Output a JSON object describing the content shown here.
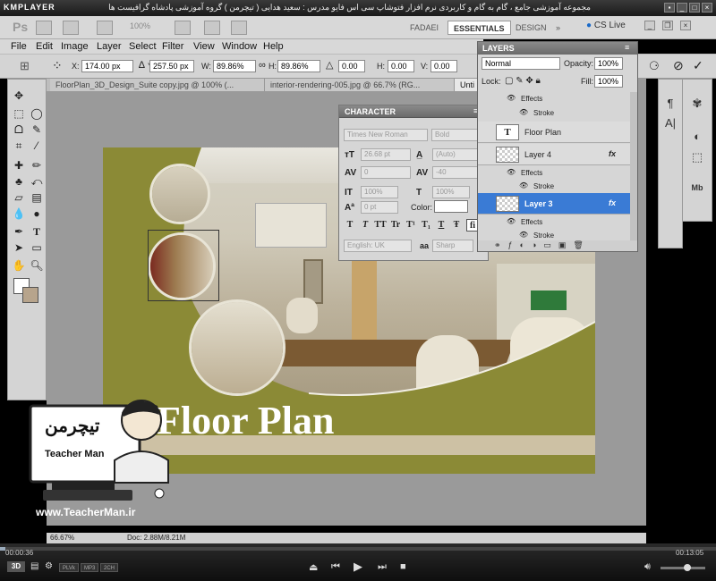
{
  "kmplayer": {
    "logo": "KMPLAYER",
    "title": "مجموعه آموزشی جامع ، گام به گام و کاربردی نرم افزار فتوشاپ سی اس فایو  مدرس : سعید هدایی ( تیچرمن ) گروه آموزشی پادشاه گرافیست ها",
    "time_elapsed": "00:00:36",
    "time_total": "00:13:05",
    "btn_3d": "3D",
    "tags": [
      "PLVk",
      "MP3",
      "2CH"
    ]
  },
  "appbar": {
    "logo": "Ps",
    "zoom": "100%",
    "workspaces": [
      "FADAEI",
      "ESSENTIALS",
      "DESIGN"
    ],
    "workspace_more": "»",
    "cs_live": "CS Live"
  },
  "menu": [
    "File",
    "Edit",
    "Image",
    "Layer",
    "Select",
    "Filter",
    "View",
    "Window",
    "Help"
  ],
  "options": {
    "x_label": "X:",
    "x_value": "174.00 px",
    "y_label": "Y:",
    "y_value": "257.50 px",
    "w_label": "W:",
    "w_value": "89.86%",
    "h_label": "H:",
    "h_value": "89.86%",
    "rot_value": "0.00",
    "hskew_label": "H:",
    "hskew_value": "0.00",
    "vskew_label": "V:",
    "vskew_value": "0.00",
    "angle_unit": "°"
  },
  "tabs": [
    {
      "label": "FloorPlan_3D_Design_Suite copy.jpg @ 100% (...",
      "active": false
    },
    {
      "label": "interior-rendering-005.jpg @ 66.7% (RG...",
      "active": false
    },
    {
      "label": "Unti",
      "active": true
    }
  ],
  "canvas": {
    "title": "Floor Plan"
  },
  "character": {
    "label": "CHARACTER",
    "font_family": "Times New Roman",
    "font_style": "Bold",
    "font_size": "26.68 pt",
    "leading": "(Auto)",
    "kerning": "0",
    "tracking": "-40",
    "vscale": "100%",
    "hscale": "100%",
    "baseline": "0 pt",
    "color_label": "Color:",
    "language": "English: UK",
    "aa_label": "aa",
    "antialias": "Sharp",
    "type_buttons": [
      "T",
      "T",
      "TT",
      "Tr",
      "T¹",
      "T₁",
      "T",
      "Ŧ",
      "fi"
    ]
  },
  "layers": {
    "label": "LAYERS",
    "blend_mode": "Normal",
    "opacity_label": "Opacity:",
    "opacity": "100%",
    "lock_label": "Lock:",
    "fill_label": "Fill:",
    "fill": "100%",
    "rows": [
      {
        "type": "sub",
        "label": "Effects"
      },
      {
        "type": "sub2",
        "label": "Stroke"
      },
      {
        "type": "layer",
        "label": "Floor Plan",
        "thumb": "T",
        "fx": false,
        "selected": false
      },
      {
        "type": "layer",
        "label": "Layer 4",
        "fx": true,
        "selected": false
      },
      {
        "type": "sub",
        "label": "Effects"
      },
      {
        "type": "sub2",
        "label": "Stroke"
      },
      {
        "type": "layer",
        "label": "Layer 3",
        "fx": true,
        "selected": true
      },
      {
        "type": "sub",
        "label": "Effects"
      },
      {
        "type": "sub2",
        "label": "Stroke"
      }
    ],
    "fx_label": "fx"
  },
  "status": {
    "zoom": "66.67%",
    "doc": "Doc: 2.88M/8.21M"
  },
  "watermark": {
    "persian": "تیچرمن",
    "sub": "Teacher Man",
    "url": "www.TeacherMan.ir"
  },
  "colors": {
    "olive": "#8b8a36",
    "selection": "#3a7bd5",
    "panel": "#d6d6d6"
  }
}
